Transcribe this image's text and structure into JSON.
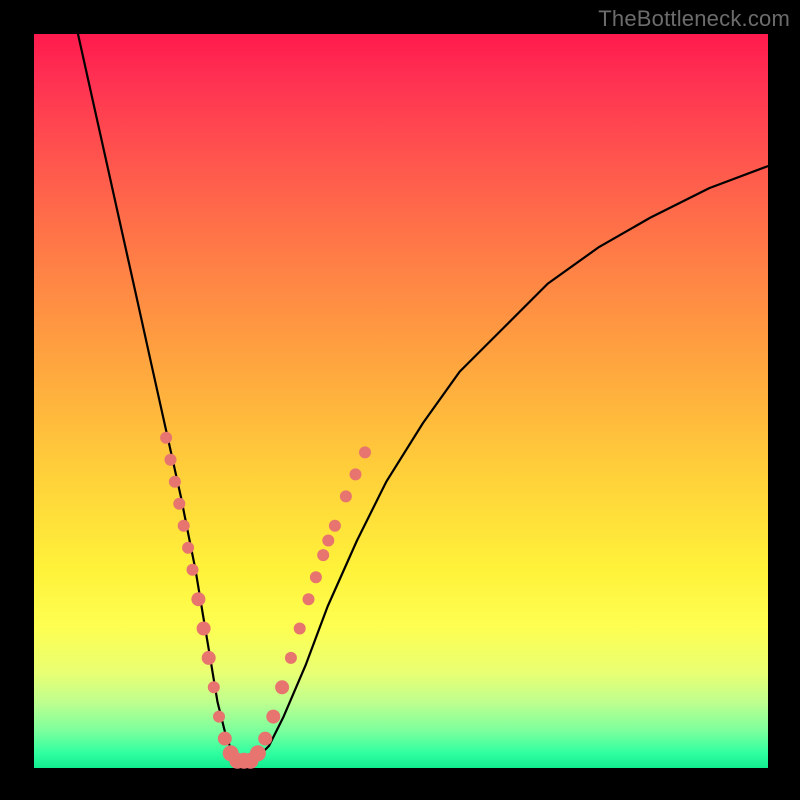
{
  "watermark": "TheBottleneck.com",
  "colors": {
    "frame_bg": "#000000",
    "curve_stroke": "#000000",
    "dot_fill": "#e7746f",
    "gradient_top": "#ff1a4d",
    "gradient_bottom": "#11ec8f"
  },
  "chart_data": {
    "type": "line",
    "title": "",
    "xlabel": "",
    "ylabel": "",
    "xlim": [
      0,
      100
    ],
    "ylim": [
      0,
      100
    ],
    "grid": false,
    "legend": false,
    "series": [
      {
        "name": "bottleneck-curve",
        "x": [
          6,
          8,
          10,
          12,
          14,
          16,
          18,
          20,
          21,
          22,
          23,
          24,
          25,
          26,
          27,
          28,
          30,
          32,
          34,
          37,
          40,
          44,
          48,
          53,
          58,
          64,
          70,
          77,
          84,
          92,
          100
        ],
        "y": [
          100,
          91,
          82,
          73,
          64,
          55,
          46,
          37,
          32,
          27,
          21,
          15,
          9,
          5,
          2,
          1,
          1,
          3,
          7,
          14,
          22,
          31,
          39,
          47,
          54,
          60,
          66,
          71,
          75,
          79,
          82
        ]
      }
    ],
    "markers": [
      {
        "x": 18.0,
        "y": 45,
        "r": 6
      },
      {
        "x": 18.6,
        "y": 42,
        "r": 6
      },
      {
        "x": 19.2,
        "y": 39,
        "r": 6
      },
      {
        "x": 19.8,
        "y": 36,
        "r": 6
      },
      {
        "x": 20.4,
        "y": 33,
        "r": 6
      },
      {
        "x": 21.0,
        "y": 30,
        "r": 6
      },
      {
        "x": 21.6,
        "y": 27,
        "r": 6
      },
      {
        "x": 22.4,
        "y": 23,
        "r": 7
      },
      {
        "x": 23.1,
        "y": 19,
        "r": 7
      },
      {
        "x": 23.8,
        "y": 15,
        "r": 7
      },
      {
        "x": 24.5,
        "y": 11,
        "r": 6
      },
      {
        "x": 25.2,
        "y": 7,
        "r": 6
      },
      {
        "x": 26.0,
        "y": 4,
        "r": 7
      },
      {
        "x": 26.8,
        "y": 2,
        "r": 8
      },
      {
        "x": 27.7,
        "y": 1,
        "r": 8
      },
      {
        "x": 28.6,
        "y": 1,
        "r": 8
      },
      {
        "x": 29.5,
        "y": 1,
        "r": 8
      },
      {
        "x": 30.5,
        "y": 2,
        "r": 8
      },
      {
        "x": 31.5,
        "y": 4,
        "r": 7
      },
      {
        "x": 32.6,
        "y": 7,
        "r": 7
      },
      {
        "x": 33.8,
        "y": 11,
        "r": 7
      },
      {
        "x": 35.0,
        "y": 15,
        "r": 6
      },
      {
        "x": 36.2,
        "y": 19,
        "r": 6
      },
      {
        "x": 37.4,
        "y": 23,
        "r": 6
      },
      {
        "x": 38.4,
        "y": 26,
        "r": 6
      },
      {
        "x": 39.4,
        "y": 29,
        "r": 6
      },
      {
        "x": 40.1,
        "y": 31,
        "r": 6
      },
      {
        "x": 41.0,
        "y": 33,
        "r": 6
      },
      {
        "x": 42.5,
        "y": 37,
        "r": 6
      },
      {
        "x": 43.8,
        "y": 40,
        "r": 6
      },
      {
        "x": 45.1,
        "y": 43,
        "r": 6
      }
    ]
  }
}
